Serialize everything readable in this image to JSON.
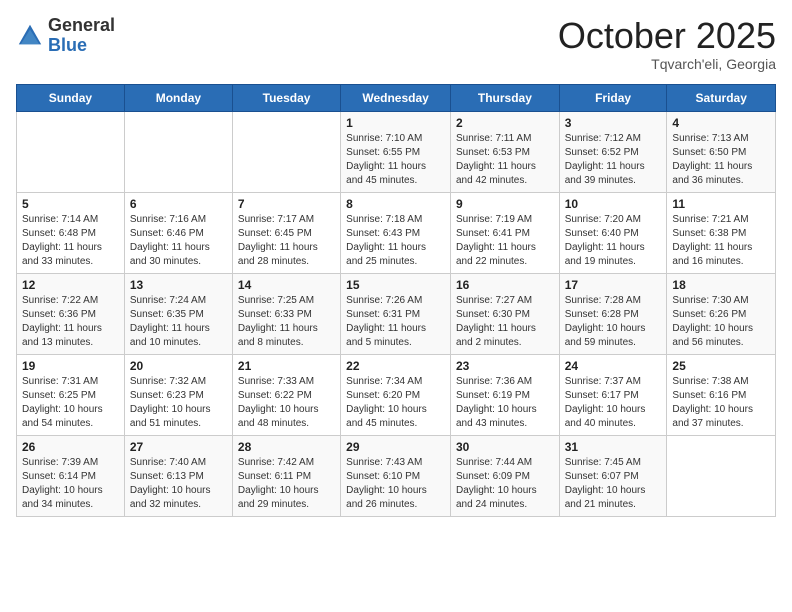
{
  "header": {
    "logo_general": "General",
    "logo_blue": "Blue",
    "month_title": "October 2025",
    "location": "Tqvarch'eli, Georgia"
  },
  "days_of_week": [
    "Sunday",
    "Monday",
    "Tuesday",
    "Wednesday",
    "Thursday",
    "Friday",
    "Saturday"
  ],
  "weeks": [
    [
      {
        "day": "",
        "info": ""
      },
      {
        "day": "",
        "info": ""
      },
      {
        "day": "",
        "info": ""
      },
      {
        "day": "1",
        "info": "Sunrise: 7:10 AM\nSunset: 6:55 PM\nDaylight: 11 hours and 45 minutes."
      },
      {
        "day": "2",
        "info": "Sunrise: 7:11 AM\nSunset: 6:53 PM\nDaylight: 11 hours and 42 minutes."
      },
      {
        "day": "3",
        "info": "Sunrise: 7:12 AM\nSunset: 6:52 PM\nDaylight: 11 hours and 39 minutes."
      },
      {
        "day": "4",
        "info": "Sunrise: 7:13 AM\nSunset: 6:50 PM\nDaylight: 11 hours and 36 minutes."
      }
    ],
    [
      {
        "day": "5",
        "info": "Sunrise: 7:14 AM\nSunset: 6:48 PM\nDaylight: 11 hours and 33 minutes."
      },
      {
        "day": "6",
        "info": "Sunrise: 7:16 AM\nSunset: 6:46 PM\nDaylight: 11 hours and 30 minutes."
      },
      {
        "day": "7",
        "info": "Sunrise: 7:17 AM\nSunset: 6:45 PM\nDaylight: 11 hours and 28 minutes."
      },
      {
        "day": "8",
        "info": "Sunrise: 7:18 AM\nSunset: 6:43 PM\nDaylight: 11 hours and 25 minutes."
      },
      {
        "day": "9",
        "info": "Sunrise: 7:19 AM\nSunset: 6:41 PM\nDaylight: 11 hours and 22 minutes."
      },
      {
        "day": "10",
        "info": "Sunrise: 7:20 AM\nSunset: 6:40 PM\nDaylight: 11 hours and 19 minutes."
      },
      {
        "day": "11",
        "info": "Sunrise: 7:21 AM\nSunset: 6:38 PM\nDaylight: 11 hours and 16 minutes."
      }
    ],
    [
      {
        "day": "12",
        "info": "Sunrise: 7:22 AM\nSunset: 6:36 PM\nDaylight: 11 hours and 13 minutes."
      },
      {
        "day": "13",
        "info": "Sunrise: 7:24 AM\nSunset: 6:35 PM\nDaylight: 11 hours and 10 minutes."
      },
      {
        "day": "14",
        "info": "Sunrise: 7:25 AM\nSunset: 6:33 PM\nDaylight: 11 hours and 8 minutes."
      },
      {
        "day": "15",
        "info": "Sunrise: 7:26 AM\nSunset: 6:31 PM\nDaylight: 11 hours and 5 minutes."
      },
      {
        "day": "16",
        "info": "Sunrise: 7:27 AM\nSunset: 6:30 PM\nDaylight: 11 hours and 2 minutes."
      },
      {
        "day": "17",
        "info": "Sunrise: 7:28 AM\nSunset: 6:28 PM\nDaylight: 10 hours and 59 minutes."
      },
      {
        "day": "18",
        "info": "Sunrise: 7:30 AM\nSunset: 6:26 PM\nDaylight: 10 hours and 56 minutes."
      }
    ],
    [
      {
        "day": "19",
        "info": "Sunrise: 7:31 AM\nSunset: 6:25 PM\nDaylight: 10 hours and 54 minutes."
      },
      {
        "day": "20",
        "info": "Sunrise: 7:32 AM\nSunset: 6:23 PM\nDaylight: 10 hours and 51 minutes."
      },
      {
        "day": "21",
        "info": "Sunrise: 7:33 AM\nSunset: 6:22 PM\nDaylight: 10 hours and 48 minutes."
      },
      {
        "day": "22",
        "info": "Sunrise: 7:34 AM\nSunset: 6:20 PM\nDaylight: 10 hours and 45 minutes."
      },
      {
        "day": "23",
        "info": "Sunrise: 7:36 AM\nSunset: 6:19 PM\nDaylight: 10 hours and 43 minutes."
      },
      {
        "day": "24",
        "info": "Sunrise: 7:37 AM\nSunset: 6:17 PM\nDaylight: 10 hours and 40 minutes."
      },
      {
        "day": "25",
        "info": "Sunrise: 7:38 AM\nSunset: 6:16 PM\nDaylight: 10 hours and 37 minutes."
      }
    ],
    [
      {
        "day": "26",
        "info": "Sunrise: 7:39 AM\nSunset: 6:14 PM\nDaylight: 10 hours and 34 minutes."
      },
      {
        "day": "27",
        "info": "Sunrise: 7:40 AM\nSunset: 6:13 PM\nDaylight: 10 hours and 32 minutes."
      },
      {
        "day": "28",
        "info": "Sunrise: 7:42 AM\nSunset: 6:11 PM\nDaylight: 10 hours and 29 minutes."
      },
      {
        "day": "29",
        "info": "Sunrise: 7:43 AM\nSunset: 6:10 PM\nDaylight: 10 hours and 26 minutes."
      },
      {
        "day": "30",
        "info": "Sunrise: 7:44 AM\nSunset: 6:09 PM\nDaylight: 10 hours and 24 minutes."
      },
      {
        "day": "31",
        "info": "Sunrise: 7:45 AM\nSunset: 6:07 PM\nDaylight: 10 hours and 21 minutes."
      },
      {
        "day": "",
        "info": ""
      }
    ]
  ]
}
